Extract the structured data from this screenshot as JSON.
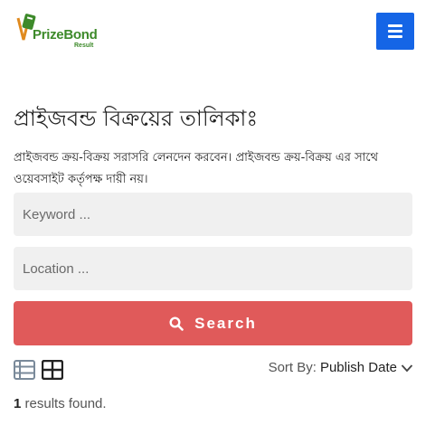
{
  "header": {
    "logo_text": "PrizeBond",
    "logo_sub": "Result",
    "menu_icon": "hamburger-icon",
    "accent_color": "#1565e6"
  },
  "page": {
    "title": "প্রাইজবন্ড বিক্রয়ের তালিকাঃ",
    "description": "প্রাইজবন্ড ক্রয়-বিক্রয় সরাসরি লেনদেন করবেন। প্রাইজবন্ড ক্রয়-বিক্রয় এর সাথে ওয়েবসাইট কর্তৃপক্ষ দায়ী নয়।"
  },
  "search": {
    "keyword_placeholder": "Keyword ...",
    "location_placeholder": "Location ...",
    "button_label": "Search",
    "button_icon": "search-icon",
    "button_color": "#e05a5a"
  },
  "toolbar": {
    "list_view_icon": "list-view-icon",
    "grid_view_icon": "grid-view-icon",
    "sort_label": "Sort By:",
    "sort_value": "Publish Date",
    "sort_icon": "chevron-down-icon"
  },
  "results": {
    "count": "1",
    "text": "results found."
  }
}
